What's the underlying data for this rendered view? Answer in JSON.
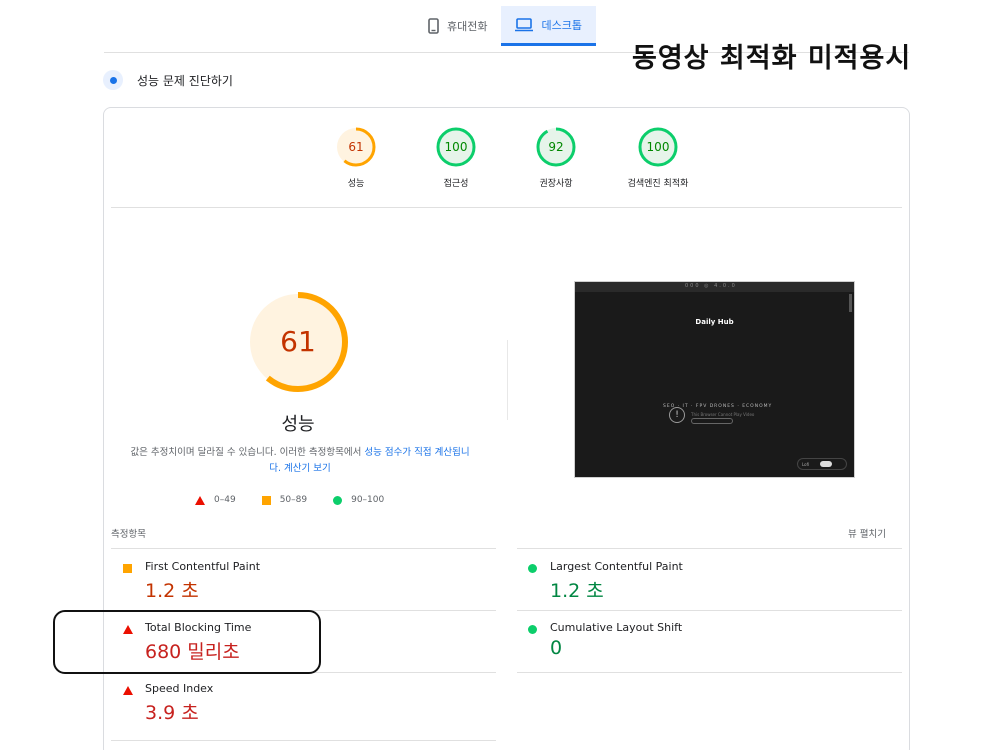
{
  "device_tabs": [
    {
      "label": "휴대전화",
      "icon": "phone-icon",
      "active": false
    },
    {
      "label": "데스크톱",
      "icon": "desktop-icon",
      "active": true
    }
  ],
  "overlay_title": "동영상 최적화 미적용시",
  "diagnose": {
    "title": "성능 문제 진단하기",
    "icon": "diagnose-icon"
  },
  "scores": [
    {
      "value": "61",
      "label": "성능",
      "score": 0.61,
      "color": "#ffa400",
      "text_color": "#c33300",
      "bg": "#fff3e0"
    },
    {
      "value": "100",
      "label": "접근성",
      "score": 1.0,
      "color": "#0cce6b",
      "text_color": "#008800",
      "bg": "#e6f4ea"
    },
    {
      "value": "92",
      "label": "권장사항",
      "score": 0.92,
      "color": "#0cce6b",
      "text_color": "#008800",
      "bg": "#e6f4ea"
    },
    {
      "value": "100",
      "label": "검색엔진 최적화",
      "score": 1.0,
      "color": "#0cce6b",
      "text_color": "#008800",
      "bg": "#e6f4ea"
    }
  ],
  "main_score": {
    "value": "61",
    "label": "성능",
    "score": 0.61
  },
  "note": {
    "text": "값은 추정치이며 달라질 수 있습니다. 이러한 측정항목에서 ",
    "link1": "성능 점수가 직접 계산됩니다.",
    "link2": "계산기 보기"
  },
  "legend": [
    {
      "shape": "triangle",
      "label": "0–49",
      "color": "#eb0f00"
    },
    {
      "shape": "square",
      "label": "50–89",
      "color": "#ffa400"
    },
    {
      "shape": "circle",
      "label": "90–100",
      "color": "#0cce6b"
    }
  ],
  "screenshot": {
    "nav": "000 ◎ 4.0.0",
    "title": "Daily Hub",
    "tags": "SEO · IT · FPV DRONES · ECONOMY",
    "sub": "This Browser Cannot Play Video",
    "toggle": "Lofi"
  },
  "metrics_label": "측정항목",
  "expand_label": "뷰 펼치기",
  "metrics": [
    {
      "name": "First Contentful Paint",
      "value": "1.2 초",
      "rating": "average"
    },
    {
      "name": "Largest Contentful Paint",
      "value": "1.2 초",
      "rating": "good"
    },
    {
      "name": "Total Blocking Time",
      "value": "680 밀리초",
      "rating": "poor"
    },
    {
      "name": "Cumulative Layout Shift",
      "value": "0",
      "rating": "good"
    },
    {
      "name": "Speed Index",
      "value": "3.9 초",
      "rating": "poor"
    }
  ],
  "colors": {
    "poor": "#eb0f00",
    "poor_text": "#c7221f",
    "average": "#ffa400",
    "average_text": "#c33300",
    "good": "#0cce6b",
    "good_text": "#018642",
    "link": "#1a73e8"
  }
}
